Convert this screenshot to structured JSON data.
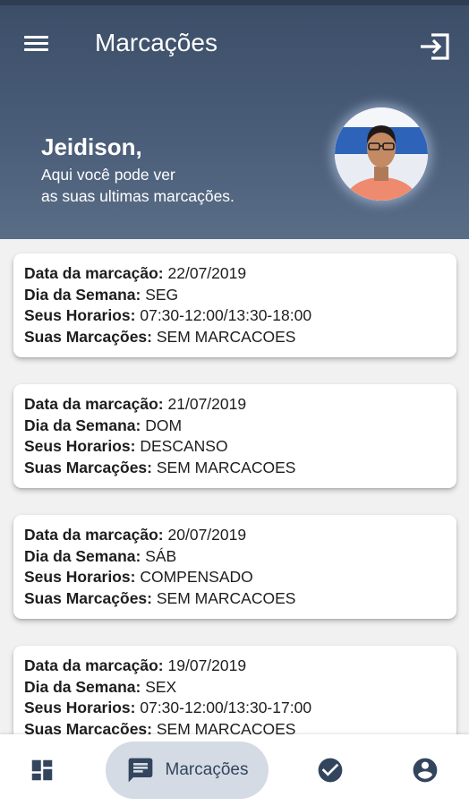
{
  "header": {
    "title": "Marcações",
    "greeting_name": "Jeidison,",
    "greeting_line1": "Aqui você pode ver",
    "greeting_line2": "as suas ultimas marcações."
  },
  "icons": {
    "menu": "menu-icon",
    "logout": "logout-icon",
    "dashboard": "dashboard-icon",
    "marcacoes": "message-icon",
    "check": "check-circle-icon",
    "profile": "account-icon"
  },
  "labels": {
    "date": "Data da marcação:",
    "weekday": "Dia da Semana:",
    "schedule": "Seus Horarios:",
    "punches": "Suas Marcações:"
  },
  "records": [
    {
      "date": "22/07/2019",
      "weekday": "SEG",
      "schedule": "07:30-12:00/13:30-18:00",
      "punches": "SEM MARCACOES"
    },
    {
      "date": "21/07/2019",
      "weekday": "DOM",
      "schedule": "DESCANSO",
      "punches": "SEM MARCACOES"
    },
    {
      "date": "20/07/2019",
      "weekday": "SÁB",
      "schedule": "COMPENSADO",
      "punches": "SEM MARCACOES"
    },
    {
      "date": "19/07/2019",
      "weekday": "SEX",
      "schedule": "07:30-12:00/13:30-17:00",
      "punches": "SEM MARCACOES"
    }
  ],
  "bottom_nav": {
    "active_label": "Marcações"
  },
  "colors": {
    "header_top": "#3c4e68",
    "header_bottom": "#5a6d87",
    "nav_active_bg": "#d4dbe5",
    "nav_icon": "#33455d"
  }
}
